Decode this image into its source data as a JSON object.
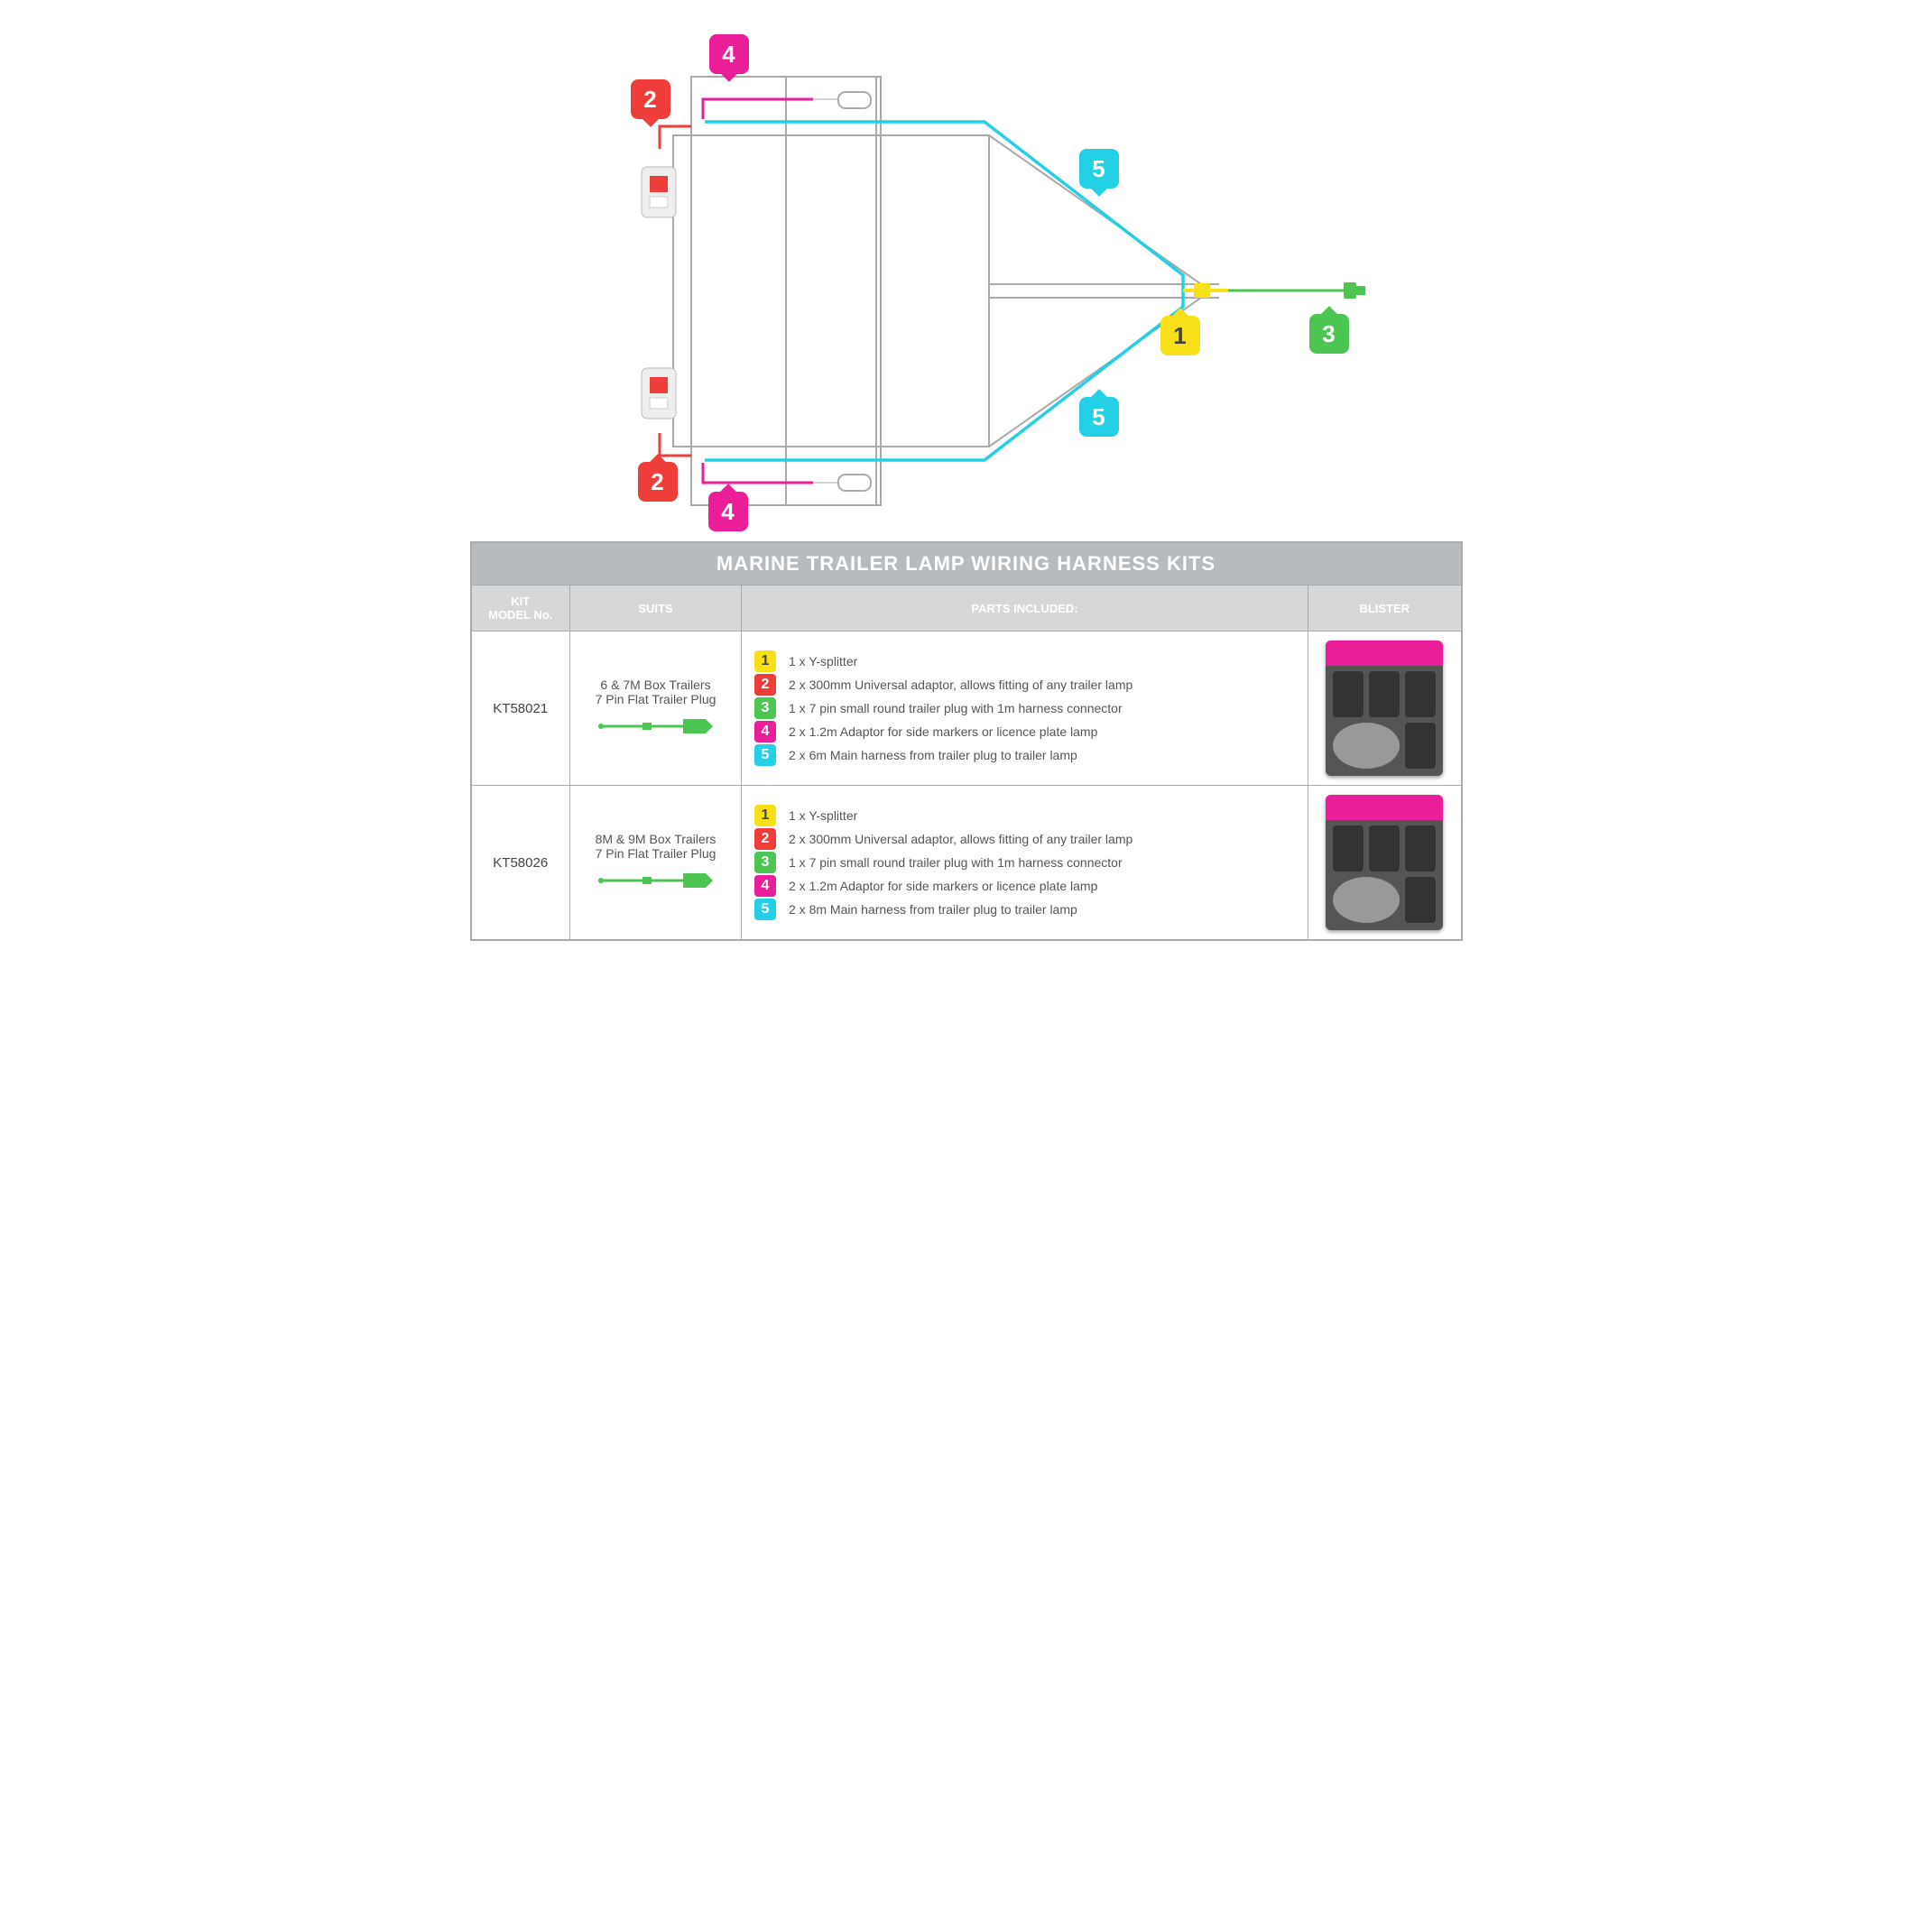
{
  "diagram": {
    "callouts": {
      "c1": "1",
      "c2": "2",
      "c3": "3",
      "c4": "4",
      "c5": "5"
    }
  },
  "table": {
    "title": "MARINE TRAILER LAMP WIRING HARNESS KITS",
    "headers": {
      "model": "KIT\nMODEL No.",
      "suits": "SUITS",
      "parts": "PARTS INCLUDED:",
      "blister": "BLISTER"
    },
    "rows": [
      {
        "model": "KT58021",
        "suits_line1": "6 & 7M Box Trailers",
        "suits_line2": "7 Pin Flat Trailer Plug",
        "parts": [
          {
            "num": "1",
            "cls": "nb-yellow",
            "text": "1 x Y-splitter"
          },
          {
            "num": "2",
            "cls": "nb-red",
            "text": "2 x 300mm Universal adaptor, allows fitting of any trailer lamp"
          },
          {
            "num": "3",
            "cls": "nb-green",
            "text": "1 x 7 pin small round trailer plug with 1m harness connector"
          },
          {
            "num": "4",
            "cls": "nb-pink",
            "text": "2 x 1.2m Adaptor for side markers or licence plate lamp"
          },
          {
            "num": "5",
            "cls": "nb-cyan",
            "text": "2 x 6m Main harness from trailer plug to trailer lamp"
          }
        ]
      },
      {
        "model": "KT58026",
        "suits_line1": "8M & 9M Box Trailers",
        "suits_line2": "7 Pin Flat Trailer Plug",
        "parts": [
          {
            "num": "1",
            "cls": "nb-yellow",
            "text": "1 x Y-splitter"
          },
          {
            "num": "2",
            "cls": "nb-red",
            "text": "2 x 300mm Universal adaptor, allows fitting of any trailer lamp"
          },
          {
            "num": "3",
            "cls": "nb-green",
            "text": "1 x 7 pin small round trailer plug with 1m harness connector"
          },
          {
            "num": "4",
            "cls": "nb-pink",
            "text": "2 x 1.2m Adaptor for side markers or licence plate lamp"
          },
          {
            "num": "5",
            "cls": "nb-cyan",
            "text": "2 x 8m Main harness from trailer plug to trailer lamp"
          }
        ]
      }
    ]
  }
}
